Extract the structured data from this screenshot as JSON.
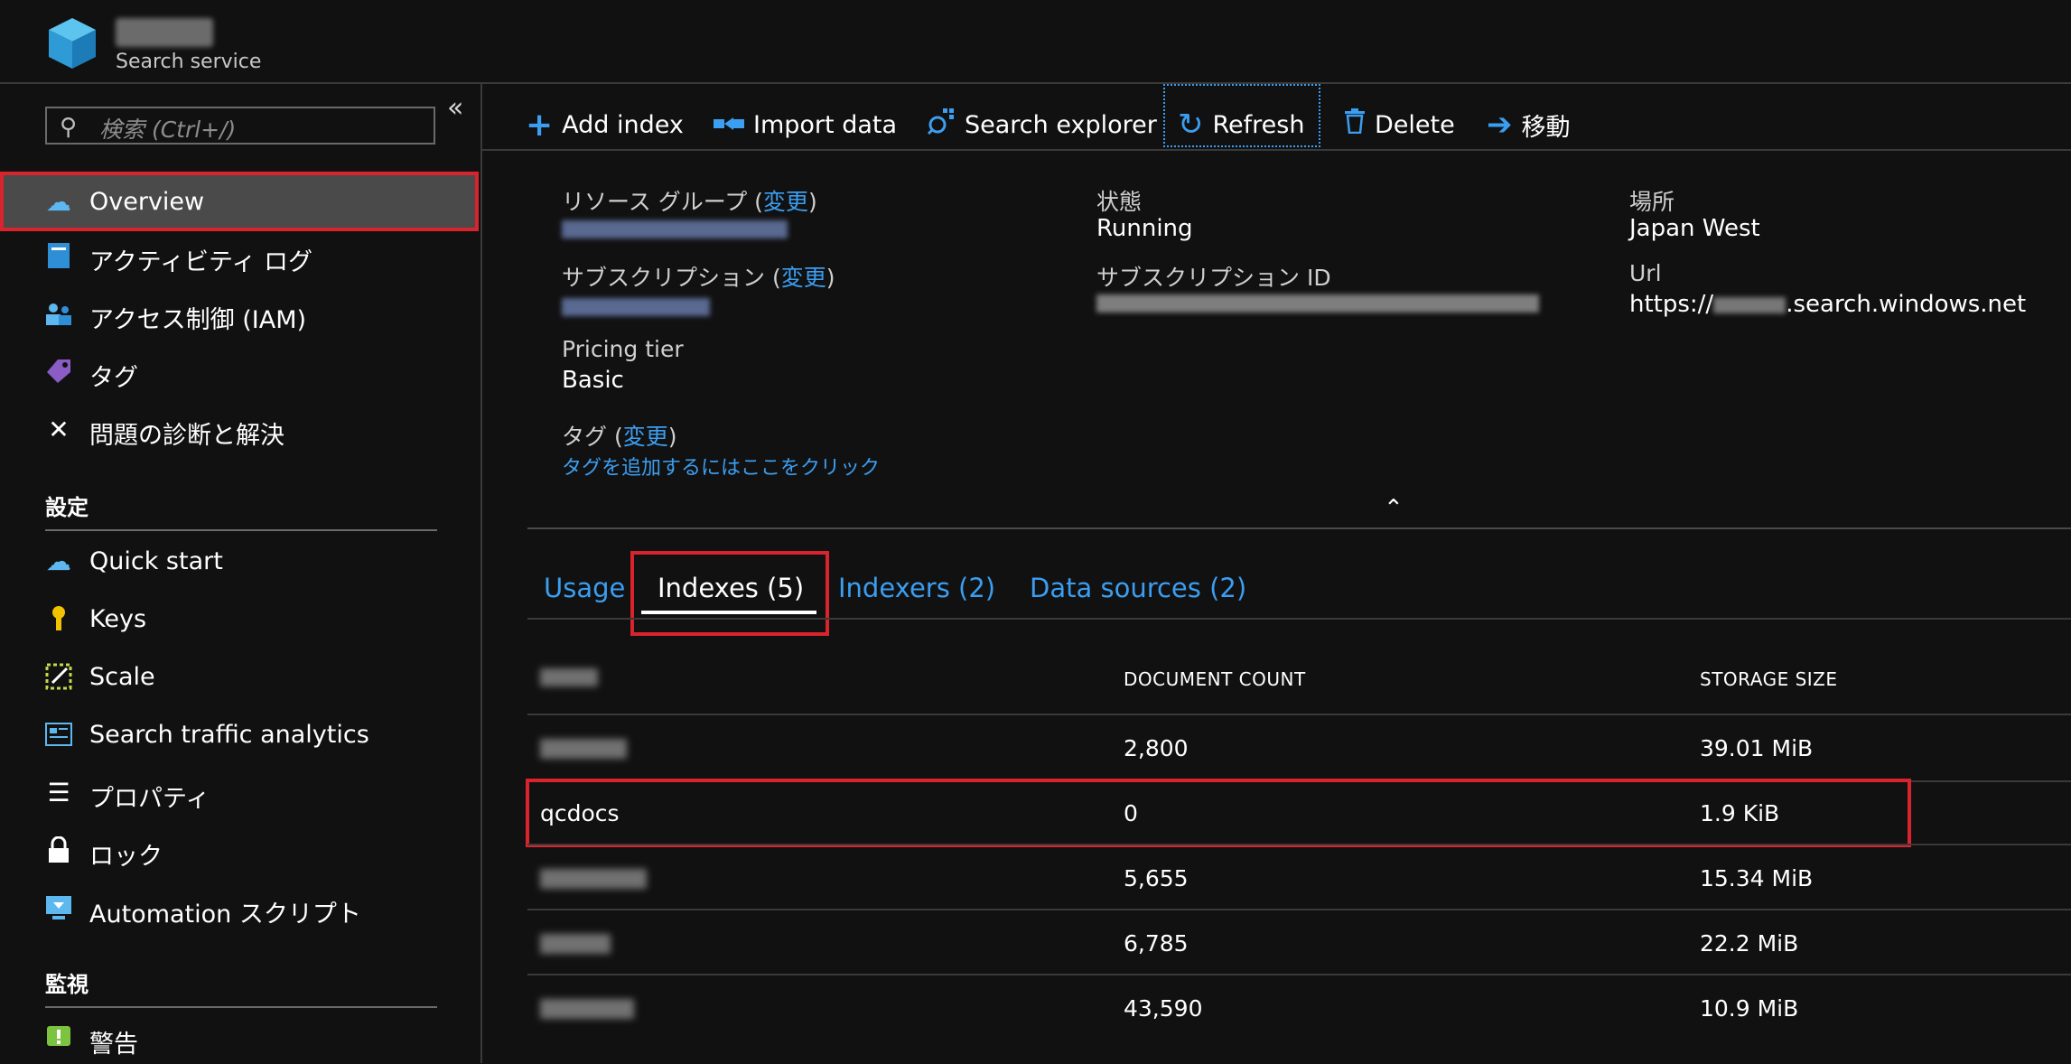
{
  "header": {
    "service_type": "Search service"
  },
  "sidebar": {
    "search_placeholder": "検索 (Ctrl+/)",
    "collapse_glyph": "«",
    "items": [
      {
        "label": "Overview",
        "icon": "cloud-search-icon",
        "selected": true
      },
      {
        "label": "アクティビティ ログ",
        "icon": "activity-log-icon"
      },
      {
        "label": "アクセス制御 (IAM)",
        "icon": "people-icon"
      },
      {
        "label": "タグ",
        "icon": "tag-icon"
      },
      {
        "label": "問題の診断と解決",
        "icon": "wrench-icon"
      }
    ],
    "section_settings": "設定",
    "settings_items": [
      {
        "label": "Quick start",
        "icon": "cloud-icon"
      },
      {
        "label": "Keys",
        "icon": "key-icon"
      },
      {
        "label": "Scale",
        "icon": "scale-icon"
      },
      {
        "label": "Search traffic analytics",
        "icon": "analytics-icon"
      },
      {
        "label": "プロパティ",
        "icon": "list-icon"
      },
      {
        "label": "ロック",
        "icon": "lock-icon"
      },
      {
        "label": "Automation スクリプト",
        "icon": "download-icon"
      }
    ],
    "section_monitoring": "監視",
    "monitoring_items": [
      {
        "label": "警告",
        "icon": "alert-icon"
      }
    ]
  },
  "toolbar": {
    "add_index": "Add index",
    "import_data": "Import data",
    "search_explorer": "Search explorer",
    "refresh": "Refresh",
    "delete": "Delete",
    "move": "移動"
  },
  "essentials": {
    "resource_group_label": "リソース グループ",
    "change_link": "変更",
    "subscription_label": "サブスクリプション",
    "pricing_tier_label": "Pricing tier",
    "pricing_tier_value": "Basic",
    "tags_label": "タグ",
    "add_tags_link": "タグを追加するにはここをクリック",
    "status_label": "状態",
    "status_value": "Running",
    "subscription_id_label": "サブスクリプション ID",
    "location_label": "場所",
    "location_value": "Japan West",
    "url_label": "Url",
    "url_prefix": "https://",
    "url_suffix": ".search.windows.net",
    "paren_open": "(",
    "paren_close": ")",
    "collapse_glyph": "⌃"
  },
  "tabs": [
    {
      "label": "Usage"
    },
    {
      "label": "Indexes (5)",
      "active": true
    },
    {
      "label": "Indexers (2)"
    },
    {
      "label": "Data sources (2)"
    }
  ],
  "table": {
    "headers": [
      "DOCUMENT COUNT",
      "STORAGE SIZE"
    ],
    "rows": [
      {
        "name": "",
        "count": "2,800",
        "size": "39.01 MiB"
      },
      {
        "name": "qcdocs",
        "count": "0",
        "size": "1.9 KiB"
      },
      {
        "name": "",
        "count": "5,655",
        "size": "15.34 MiB"
      },
      {
        "name": "",
        "count": "6,785",
        "size": "22.2 MiB"
      },
      {
        "name": "",
        "count": "43,590",
        "size": "10.9 MiB"
      }
    ]
  },
  "colors": {
    "accent": "#3b9ef0",
    "highlight": "#d9232d",
    "background": "#111112"
  }
}
